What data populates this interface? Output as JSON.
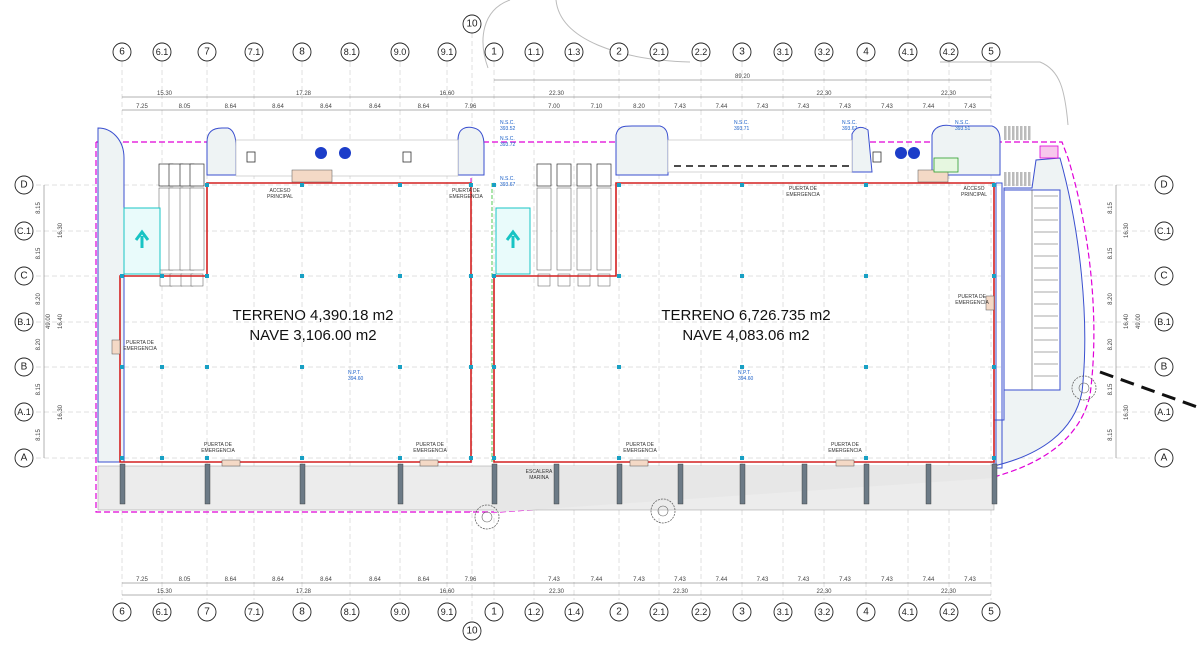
{
  "columns_top": [
    "6",
    "6.1",
    "7",
    "7.1",
    "8",
    "8.1",
    "9.0",
    "9.1",
    "1",
    "1.1",
    "1.3",
    "2",
    "2.1",
    "2.2",
    "3",
    "3.1",
    "3.2",
    "4",
    "4.1",
    "4.2",
    "5"
  ],
  "columns_bottom": [
    "6",
    "6.1",
    "7",
    "7.1",
    "8",
    "8.1",
    "9.0",
    "9.1",
    "1",
    "1.2",
    "1.4",
    "2",
    "2.1",
    "2.2",
    "3",
    "3.1",
    "3.2",
    "4",
    "4.1",
    "4.2",
    "5"
  ],
  "extra_axis": "10",
  "rows": [
    "D",
    "C.1",
    "C",
    "B.1",
    "B",
    "A.1",
    "A"
  ],
  "dims_top_group_left": [
    "15.30",
    "17.28",
    "16.60"
  ],
  "dims_top_total": "89.20",
  "dims_top_group_right": [
    "22.30",
    "22.30",
    "22.30"
  ],
  "dims_top_spans": [
    "7.25",
    "8.05",
    "8.64",
    "8.64",
    "8.64",
    "8.64",
    "8.64",
    "7.96",
    "7.00",
    "7.10",
    "8.20",
    "7.43",
    "7.44",
    "7.43",
    "7.43",
    "7.43",
    "7.43",
    "7.44",
    "7.43"
  ],
  "dims_bottom_spans": [
    "7.25",
    "8.05",
    "8.64",
    "8.64",
    "8.64",
    "8.64",
    "8.64",
    "7.96",
    "7.43",
    "7.44",
    "7.43",
    "7.43",
    "7.44",
    "7.43",
    "7.43",
    "7.43",
    "7.43",
    "7.44",
    "7.43"
  ],
  "dims_bottom_group": [
    "15.30",
    "17.28",
    "16.60",
    "22.30",
    "22.30",
    "22.30",
    "22.30"
  ],
  "dims_vertical_inner": [
    "8.15",
    "8.15",
    "8.20",
    "8.20",
    "8.15",
    "8.15"
  ],
  "dims_vertical_mid": [
    "16.30",
    "16.40",
    "16.30"
  ],
  "dims_vertical_total": "49.00",
  "building_left": {
    "terreno": "TERRENO 4,390.18 m2",
    "nave": "NAVE 3,106.00 m2"
  },
  "building_right": {
    "terreno": "TERRENO 6,726.735 m2",
    "nave": "NAVE 4,083.06 m2"
  },
  "notes": {
    "acceso": [
      "ACCESO",
      "PRINCIPAL"
    ],
    "puerta": [
      "PUERTA DE",
      "EMERGENCIA"
    ],
    "escalera": [
      "ESCALERA",
      "MARINA"
    ],
    "nsc": "N.S.C.",
    "npt": "N.P.T.",
    "levels_nsc": [
      "393.52",
      "393.72",
      "393.67",
      "393.71",
      "393.67",
      "393.51"
    ],
    "levels_npt": [
      "394.60",
      "394.60"
    ]
  },
  "colors": {
    "building_outline": "#d42020",
    "property_line": "#e000d8",
    "site_edge": "#3a4fcf",
    "cyan_accent": "#18c4c4",
    "landscape": "#9ab0b8",
    "grid_line": "#b0b0b0"
  }
}
